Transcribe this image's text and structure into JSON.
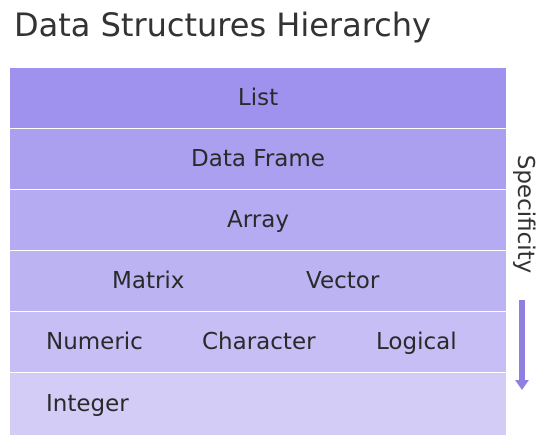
{
  "title": "Data Structures Hierarchy",
  "levels": [
    {
      "items": [
        "List"
      ]
    },
    {
      "items": [
        "Data Frame"
      ]
    },
    {
      "items": [
        "Array"
      ]
    },
    {
      "items": [
        "Matrix",
        "Vector"
      ]
    },
    {
      "items": [
        "Numeric",
        "Character",
        "Logical"
      ]
    },
    {
      "items": [
        "Integer"
      ]
    }
  ],
  "side_label": "Specificity",
  "colors": {
    "level_fills": [
      "#9f92ee",
      "#ab9ff0",
      "#b5abf2",
      "#bcb3f3",
      "#c6bef5",
      "#d2ccf7"
    ],
    "arrow": "#8e7fe0"
  }
}
